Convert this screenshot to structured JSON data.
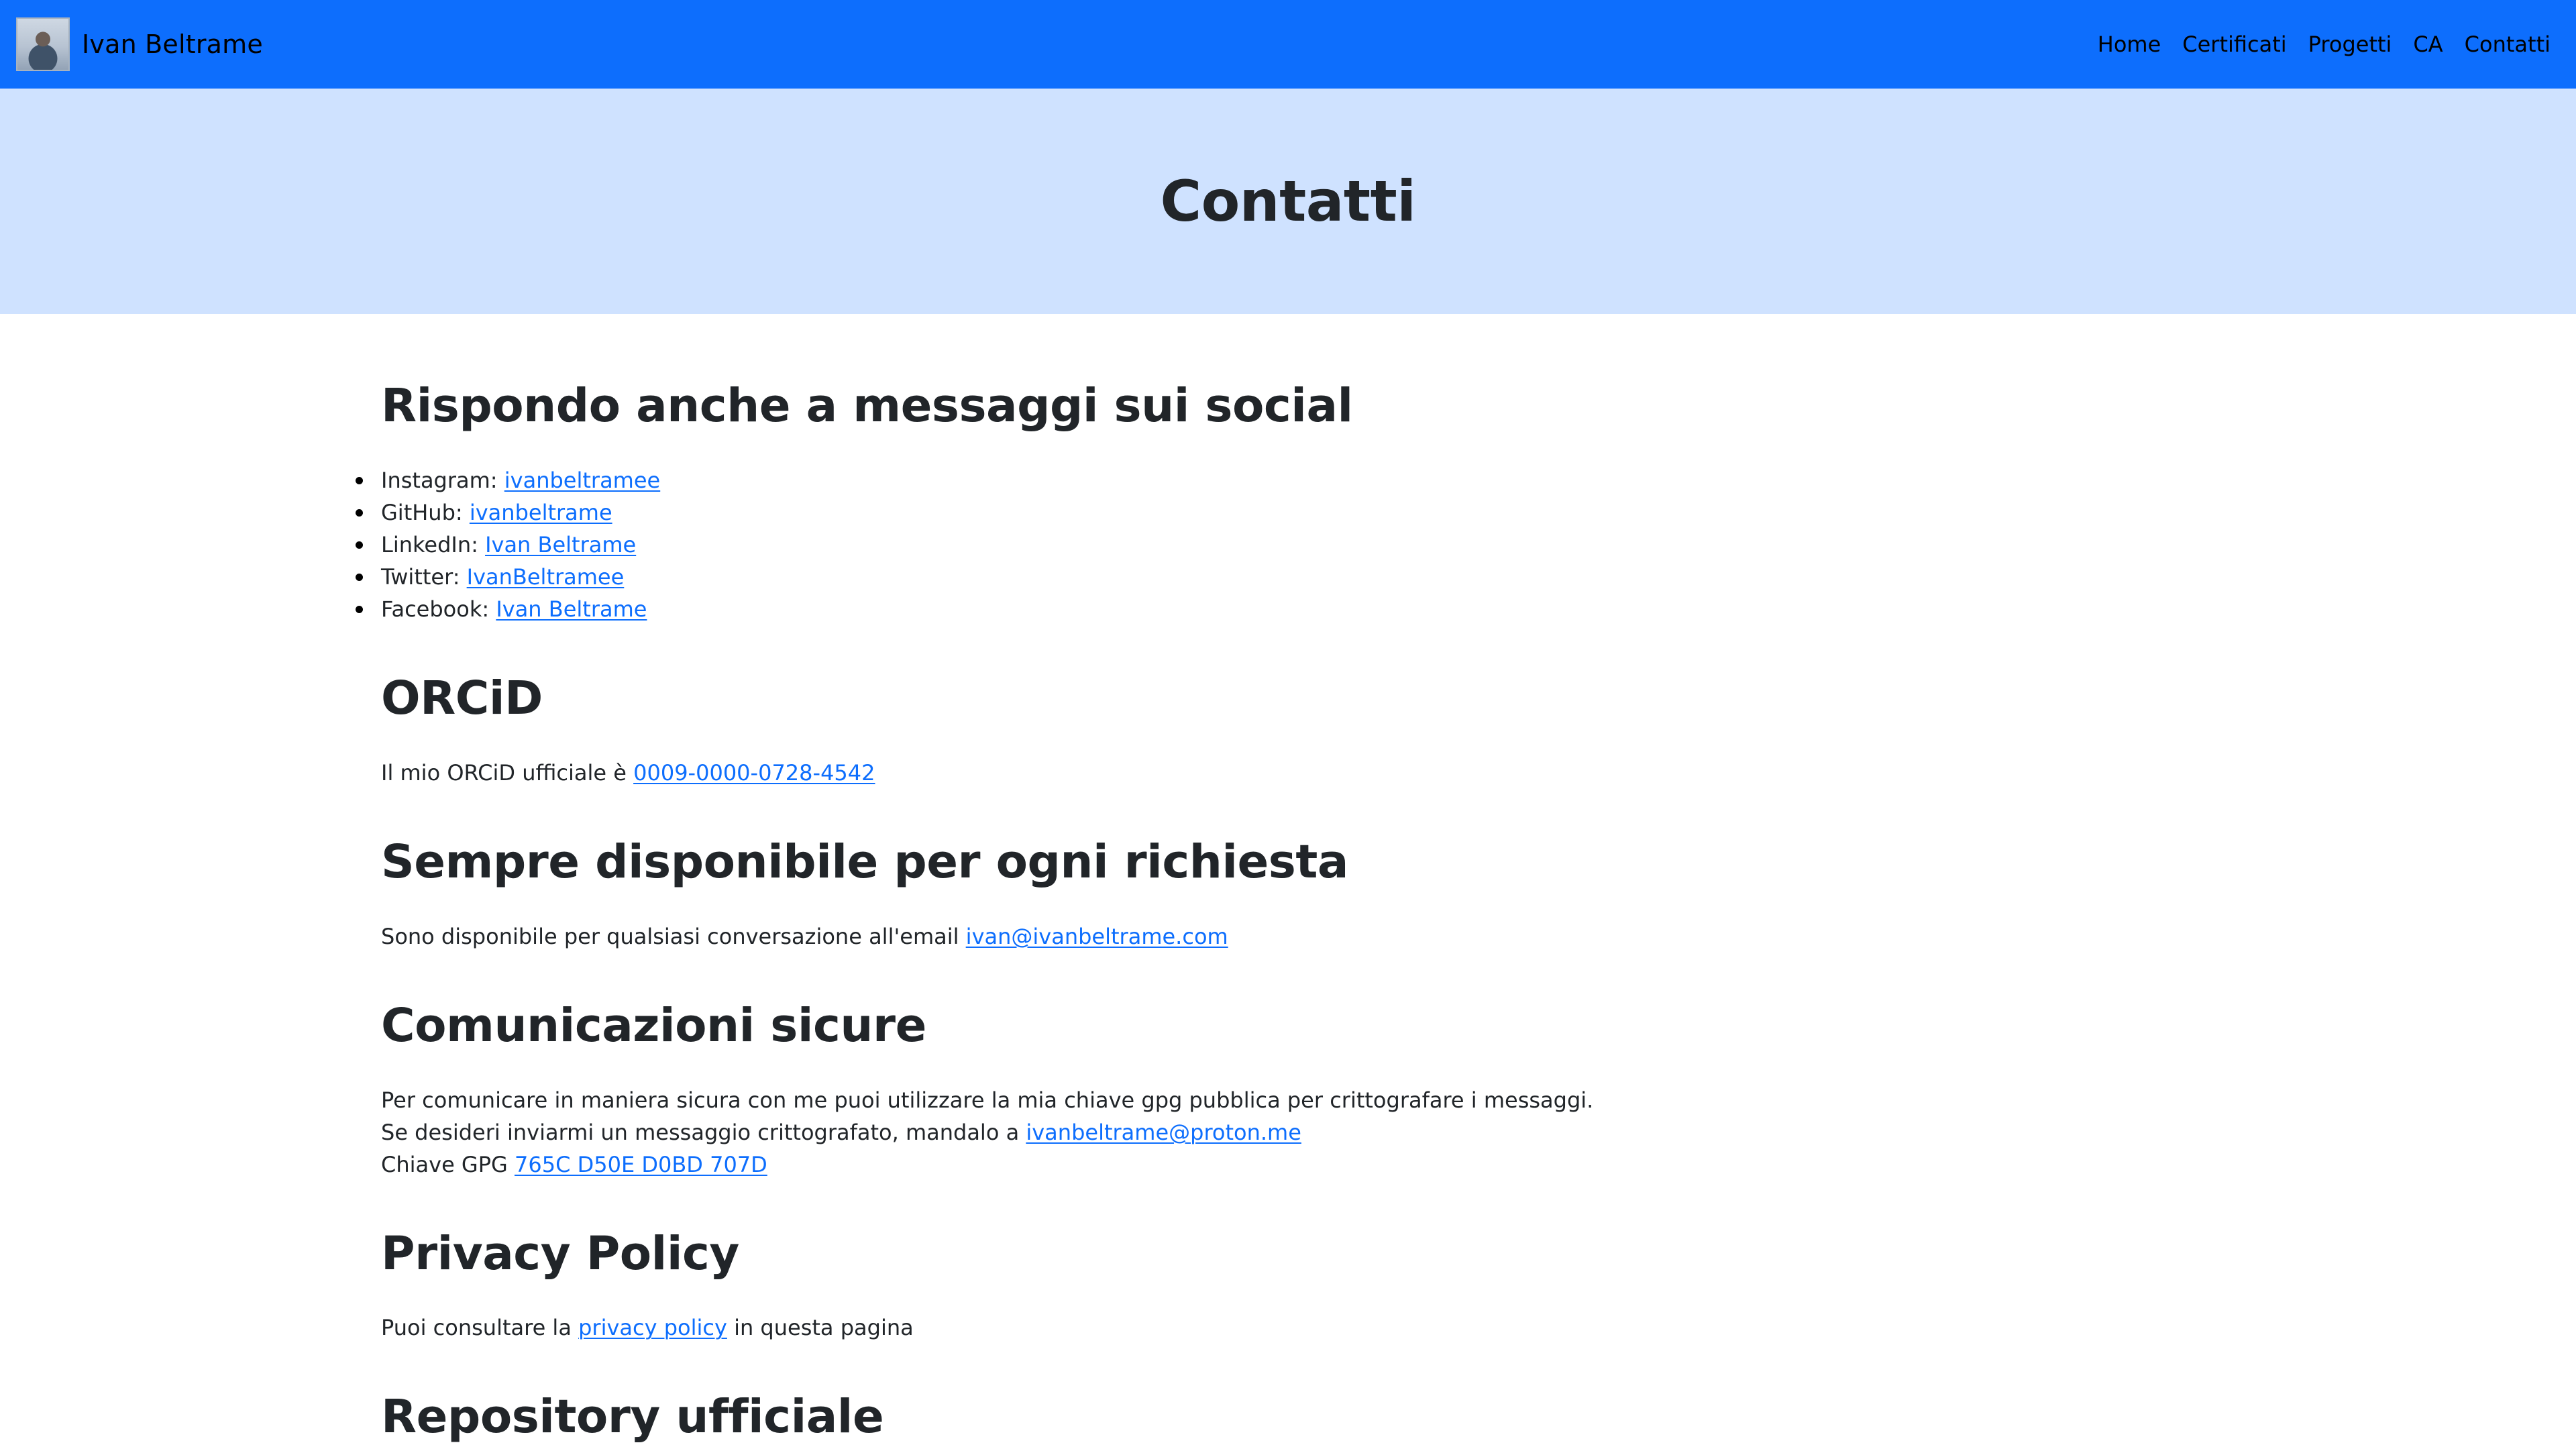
{
  "navbar": {
    "brand": "Ivan Beltrame",
    "links": [
      "Home",
      "Certificati",
      "Progetti",
      "CA",
      "Contatti"
    ]
  },
  "hero": {
    "title": "Contatti"
  },
  "social": {
    "title": "Rispondo anche a messaggi sui social",
    "items": [
      {
        "label": "Instagram:",
        "link": "ivanbeltramee"
      },
      {
        "label": "GitHub:",
        "link": "ivanbeltrame"
      },
      {
        "label": "LinkedIn:",
        "link": "Ivan Beltrame"
      },
      {
        "label": "Twitter:",
        "link": "IvanBeltramee"
      },
      {
        "label": "Facebook:",
        "link": "Ivan Beltrame"
      }
    ]
  },
  "orcid": {
    "title": "ORCiD",
    "text": "Il mio ORCiD ufficiale è",
    "link": "0009-0000-0728-4542"
  },
  "availability": {
    "title": "Sempre disponibile per ogni richiesta",
    "text": "Sono disponibile per qualsiasi conversazione all'email",
    "link": "ivan@ivanbeltrame.com"
  },
  "secure": {
    "title": "Comunicazioni sicure",
    "line1": "Per comunicare in maniera sicura con me puoi utilizzare la mia chiave gpg pubblica per crittografare i messaggi.",
    "line2_text": "Se desideri inviarmi un messaggio crittografato, mandalo a",
    "line2_link": "ivanbeltrame@proton.me",
    "line3_text": "Chiave GPG",
    "line3_link": "765C D50E D0BD 707D"
  },
  "privacy": {
    "title": "Privacy Policy",
    "text_before": "Puoi consultare la",
    "link": "privacy policy",
    "text_after": "in questa pagina"
  },
  "repository": {
    "title": "Repository ufficiale"
  },
  "colors": {
    "navbar": "#0d6efd",
    "hero_bg": "#cfe2ff",
    "link": "#0d6efd",
    "text": "#212529"
  }
}
